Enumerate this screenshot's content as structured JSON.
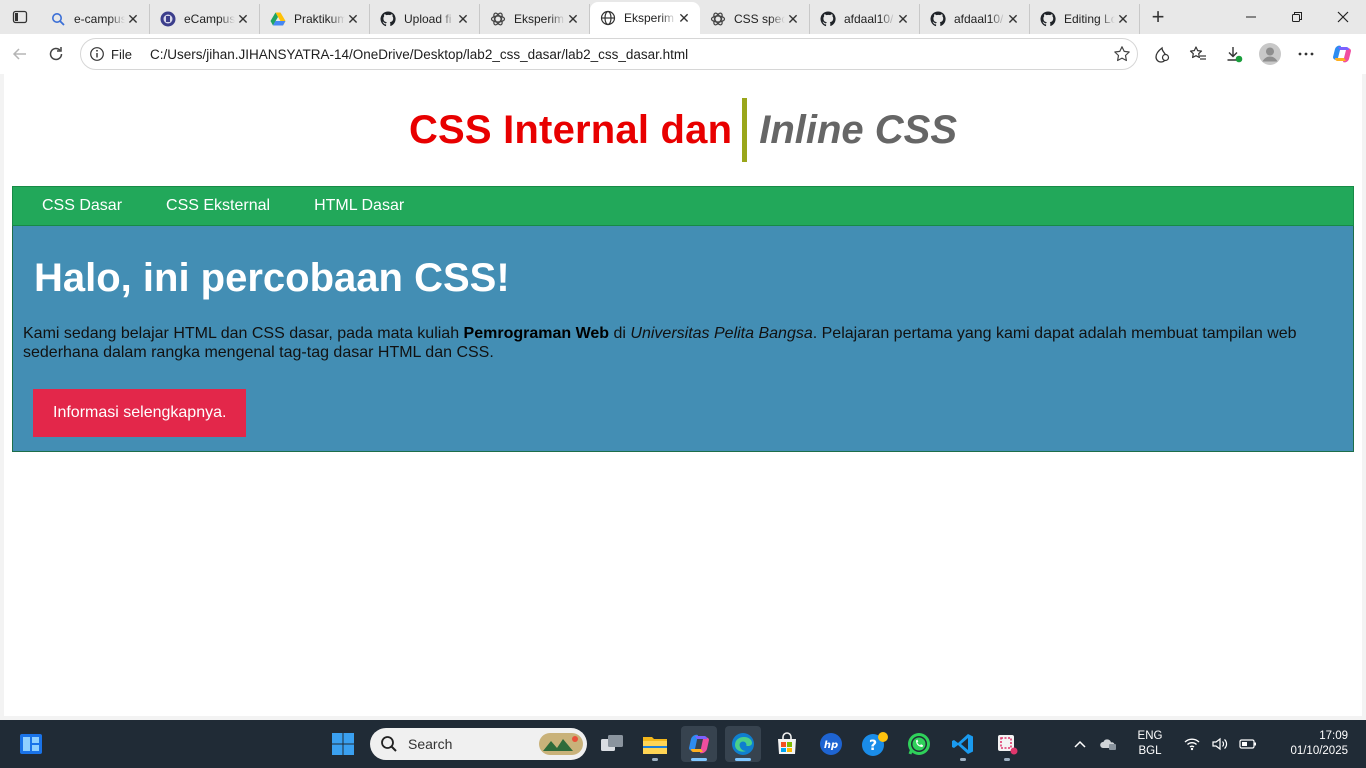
{
  "browser": {
    "tabs": [
      {
        "title": "e-campus",
        "icon": "search-icon",
        "active": false
      },
      {
        "title": "eCampus",
        "icon": "university-logo-icon",
        "active": false
      },
      {
        "title": "Praktikum",
        "icon": "google-drive-icon",
        "active": false
      },
      {
        "title": "Upload fi",
        "icon": "github-icon",
        "active": false
      },
      {
        "title": "Eksperim",
        "icon": "openai-icon",
        "active": false
      },
      {
        "title": "Eksperim",
        "icon": "globe-icon",
        "active": true
      },
      {
        "title": "CSS spec",
        "icon": "openai-icon",
        "active": false
      },
      {
        "title": "afdaal10/",
        "icon": "github-icon",
        "active": false
      },
      {
        "title": "afdaal10/",
        "icon": "github-icon",
        "active": false
      },
      {
        "title": "Editing Lo",
        "icon": "github-icon",
        "active": false
      }
    ],
    "file_chip": "File",
    "url": "C:/Users/jihan.JIHANSYATRA-14/OneDrive/Desktop/lab2_css_dasar/lab2_css_dasar.html"
  },
  "page": {
    "header_red": "CSS Internal dan",
    "header_grey": "Inline CSS",
    "nav": [
      "CSS Dasar",
      "CSS Eksternal",
      "HTML Dasar"
    ],
    "hero_title": "Halo, ini percobaan CSS!",
    "para_1": "Kami sedang belajar HTML dan CSS dasar, pada mata kuliah ",
    "para_bold": "Pemrograman Web",
    "para_2": " di ",
    "para_italic": "Universitas Pelita Bangsa",
    "para_3": ". Pelajaran pertama yang kami dapat adalah membuat tampilan web sederhana dalam rangka mengenal tag-tag dasar HTML dan CSS.",
    "button": "Informasi selengkapnya."
  },
  "taskbar": {
    "search_label": "Search",
    "lang_line1": "ENG",
    "lang_line2": "BGL",
    "time": "17:09",
    "date": "01/10/2025"
  },
  "colors": {
    "header_red": "#e80000",
    "header_grey": "#666666",
    "nav_green": "#22a85a",
    "hero_blue": "#438eb4",
    "button_red": "#e3274a",
    "divider_olive": "#9aa61a"
  }
}
